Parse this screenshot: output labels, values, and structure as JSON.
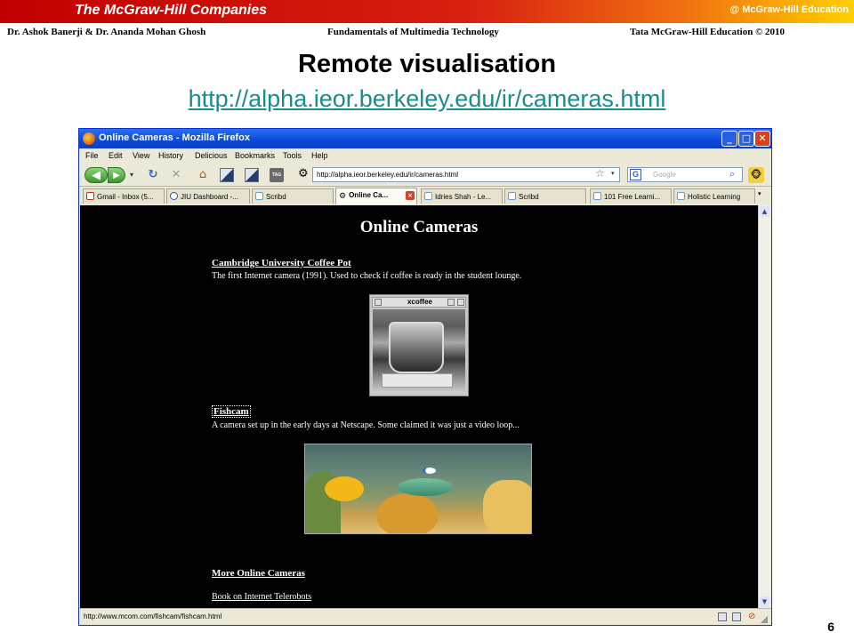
{
  "slide": {
    "brand": "The McGraw-Hill Companies",
    "edu_tag": "@ McGraw-Hill Education",
    "credit_authors": "Dr. Ashok Banerji   & Dr. Ananda Mohan Ghosh",
    "credit_book": "Fundamentals of Multimedia Technology",
    "credit_publisher": "Tata McGraw-Hill Education   © 2010",
    "title": "Remote visualisation",
    "url": "http://alpha.ieor.berkeley.edu/ir/cameras.html",
    "page_number": "6"
  },
  "browser": {
    "window_title": "Online Cameras - Mozilla Firefox",
    "window_buttons": {
      "minimize": "_",
      "maximize": "□",
      "close": "✕"
    },
    "menu": [
      "File",
      "Edit",
      "View",
      "History",
      "Delicious",
      "Bookmarks",
      "Tools",
      "Help"
    ],
    "nav": {
      "back": "◀",
      "forward": "▶",
      "history_drop": "▾",
      "reload": "↻",
      "stop": "✕",
      "home": "⌂",
      "tag": "TAG",
      "gear": "⚙"
    },
    "address": "http://alpha.ieor.berkeley.edu/ir/cameras.html",
    "bookmark_star": "☆",
    "url_drop": "▾",
    "search": {
      "engine": "G",
      "placeholder": "Google",
      "go": "⌕"
    },
    "greasemonkey": "🐵",
    "tabs": [
      {
        "label": "Gmail - Inbox (5...",
        "active": false
      },
      {
        "label": "JIU Dashboard -...",
        "active": false
      },
      {
        "label": "Scribd",
        "active": false
      },
      {
        "label": "Online Ca...",
        "active": true,
        "close": "×"
      },
      {
        "label": "Idries Shah - Le...",
        "active": false
      },
      {
        "label": "Scribd",
        "active": false
      },
      {
        "label": "101 Free Learni...",
        "active": false
      },
      {
        "label": "Holistic Learning",
        "active": false
      }
    ],
    "tab_scroll": "▾",
    "scroll": {
      "up": "▲",
      "down": "▼"
    },
    "status_url": "http://www.mcom.com/fishcam/fishcam.html",
    "status_red": "⊘"
  },
  "page": {
    "heading": "Online Cameras",
    "coffee_link": "Cambridge University Coffee Pot",
    "coffee_desc": "The first Internet camera (1991). Used to check if coffee is ready in the student lounge.",
    "xcoffee_title": "xcoffee",
    "fishcam_link": "Fishcam",
    "fishcam_desc": "A camera set up in the early days at Netscape. Some claimed it was just a video loop...",
    "more_link": "More Online Cameras",
    "book_link": "Book on Internet Telerobots"
  }
}
